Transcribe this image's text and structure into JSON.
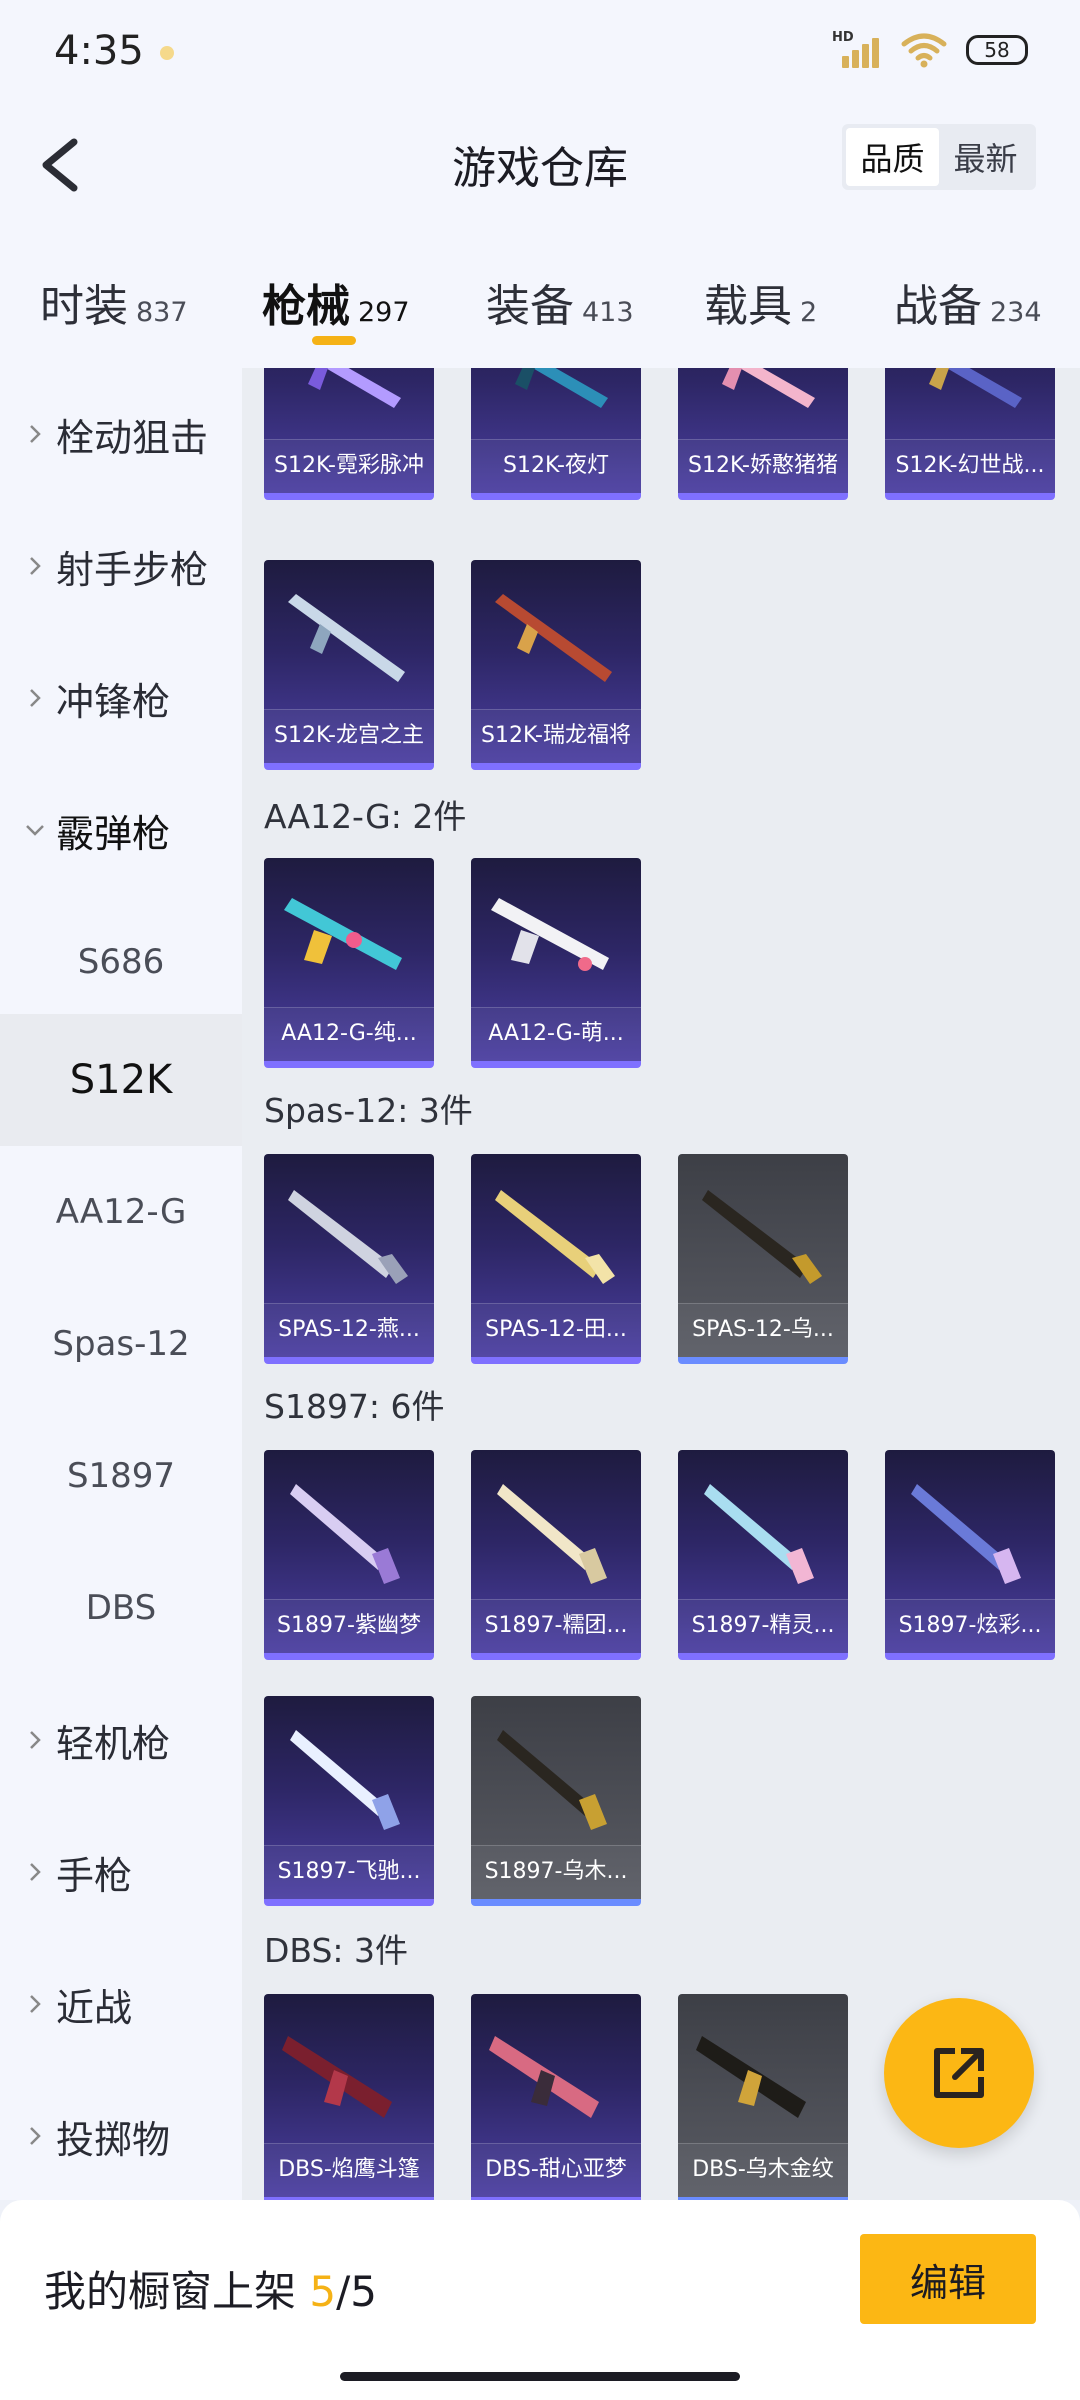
{
  "status_bar": {
    "time": "4:35",
    "hd_label": "HD",
    "battery": "58"
  },
  "header": {
    "title": "游戏仓库",
    "sort_options": [
      "品质",
      "最新"
    ]
  },
  "tabs": [
    {
      "label": "时装",
      "count": "837"
    },
    {
      "label": "枪械",
      "count": "297"
    },
    {
      "label": "装备",
      "count": "413"
    },
    {
      "label": "载具",
      "count": "2"
    },
    {
      "label": "战备",
      "count": "234"
    }
  ],
  "sidebar": {
    "categories": {
      "bolt_sniper": "栓动狙击",
      "marksman": "射手步枪",
      "smg": "冲锋枪",
      "shotgun": "霰弹枪",
      "lmg": "轻机枪",
      "pistol": "手枪",
      "melee": "近战",
      "throwable": "投掷物"
    },
    "shotgun_subs": [
      "S686",
      "S12K",
      "AA12-G",
      "Spas-12",
      "S1897",
      "DBS"
    ],
    "selected_sub": "S12K"
  },
  "groups": {
    "s12k_items": [
      "S12K-霓彩脉冲",
      "S12K-夜灯",
      "S12K-娇憨猪猪",
      "S12K-幻世战...",
      "S12K-龙宫之主",
      "S12K-瑞龙福将"
    ],
    "aa12": {
      "title": "AA12-G: 2件",
      "items": [
        "AA12-G-纯...",
        "AA12-G-萌..."
      ]
    },
    "spas": {
      "title": "Spas-12: 3件",
      "items": [
        "SPAS-12-燕...",
        "SPAS-12-田...",
        "SPAS-12-乌..."
      ]
    },
    "s1897": {
      "title": "S1897: 6件",
      "items": [
        "S1897-紫幽梦",
        "S1897-糯团...",
        "S1897-精灵...",
        "S1897-炫彩...",
        "S1897-飞驰...",
        "S1897-乌木..."
      ]
    },
    "dbs": {
      "title": "DBS: 3件",
      "items": [
        "DBS-焰鹰斗篷",
        "DBS-甜心亚梦",
        "DBS-乌木金纹"
      ]
    }
  },
  "bottom_bar": {
    "label": "我的橱窗上架",
    "current": "5",
    "separator": "/",
    "total": "5",
    "edit_label": "编辑"
  },
  "colors": {
    "accent": "#fcb714",
    "card_purple": "#4b3fa1",
    "card_gray": "#595b63"
  },
  "icons": {
    "back": "chevron-left-icon",
    "share": "share-external-icon",
    "expand": "chevron-right-icon",
    "collapse": "chevron-down-icon"
  }
}
